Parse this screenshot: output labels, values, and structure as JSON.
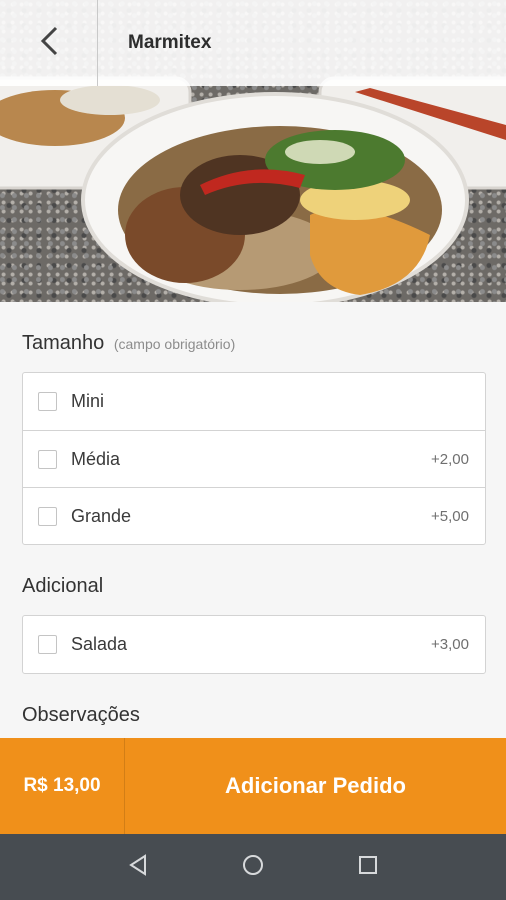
{
  "appbar": {
    "title": "Marmitex",
    "back_icon": "chevron-left-icon"
  },
  "sections": {
    "size": {
      "title": "Tamanho",
      "hint": "(campo obrigatório)",
      "options": [
        {
          "label": "Mini",
          "price": ""
        },
        {
          "label": "Média",
          "price": "+2,00"
        },
        {
          "label": "Grande",
          "price": "+5,00"
        }
      ]
    },
    "extras": {
      "title": "Adicional",
      "options": [
        {
          "label": "Salada",
          "price": "+3,00"
        }
      ]
    },
    "notes": {
      "title": "Observações"
    }
  },
  "actionbar": {
    "total": "R$ 13,00",
    "add_label": "Adicionar Pedido",
    "accent_color": "#f0901a"
  },
  "navbar": {
    "back_icon": "triangle-back-icon",
    "home_icon": "circle-home-icon",
    "recents_icon": "square-recents-icon",
    "background": "#474c51"
  }
}
